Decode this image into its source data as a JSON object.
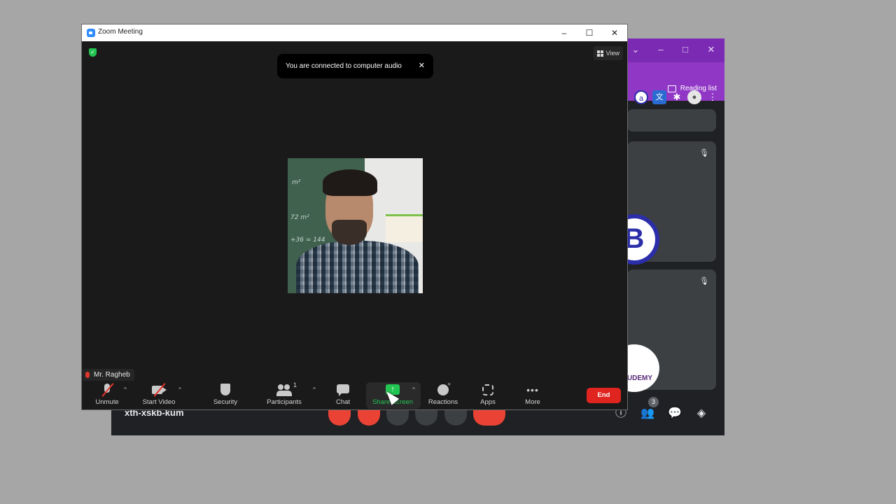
{
  "browser": {
    "reading_list_label": "Reading list",
    "meet_code": "xth-xskb-kum",
    "participant_count": "3",
    "tile_b_letter": "B",
    "tile_u_text": "UDEMY"
  },
  "zoom": {
    "window_title": "Zoom Meeting",
    "view_label": "View",
    "toast_text": "You are connected to computer audio",
    "participant_name": "Mr. Ragheb",
    "participants_count": "1",
    "toolbar": {
      "unmute": "Unmute",
      "start_video": "Start Video",
      "security": "Security",
      "participants": "Participants",
      "chat": "Chat",
      "share_screen": "Share Screen",
      "reactions": "Reactions",
      "apps": "Apps",
      "more": "More",
      "end": "End"
    },
    "colors": {
      "share_green": "#23c552",
      "end_red": "#e0241f",
      "browser_purple": "#9037c6"
    }
  },
  "video": {
    "board_texts": [
      "m²",
      "72 m²",
      "+36 = 144"
    ]
  }
}
